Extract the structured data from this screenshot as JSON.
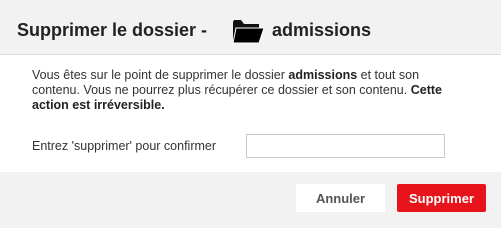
{
  "header": {
    "title": "Supprimer le dossier -",
    "folder_icon": "folder-icon",
    "folder_name": "admissions"
  },
  "message": {
    "part1": "Vous êtes sur le point de supprimer le dossier ",
    "folder_name": "admissions",
    "part2": " et tout son contenu. Vous ne pourrez plus récupérer ce dossier et son contenu. ",
    "warning": "Cette action est irréversible."
  },
  "confirm": {
    "label": "Entrez 'supprimer' pour confirmer",
    "value": "",
    "placeholder": ""
  },
  "buttons": {
    "cancel_label": "Annuler",
    "delete_label": "Supprimer"
  },
  "colors": {
    "delete_button": "#e8141c",
    "header_bg": "#f2f2f2"
  }
}
